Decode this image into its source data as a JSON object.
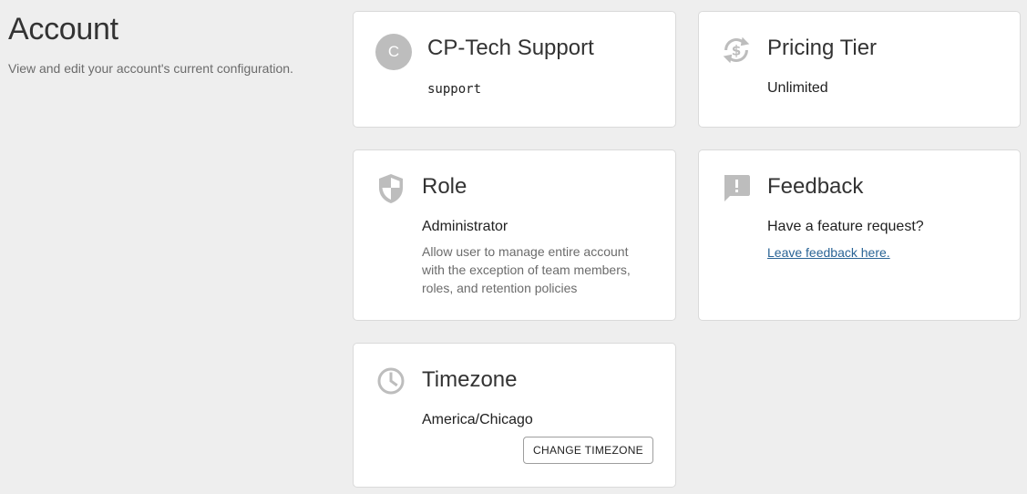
{
  "header": {
    "title": "Account",
    "subtitle": "View and edit your account's current configuration."
  },
  "account_card": {
    "avatar_letter": "C",
    "name": "CP-Tech Support",
    "username": "support"
  },
  "pricing_card": {
    "icon": "dollar-refresh-icon",
    "title": "Pricing Tier",
    "value": "Unlimited"
  },
  "role_card": {
    "icon": "shield-icon",
    "title": "Role",
    "value": "Administrator",
    "description": "Allow user to manage entire account with the exception of team members, roles, and retention policies"
  },
  "feedback_card": {
    "icon": "feedback-icon",
    "title": "Feedback",
    "prompt": "Have a feature request?",
    "link_label": "Leave feedback here."
  },
  "timezone_card": {
    "icon": "clock-icon",
    "title": "Timezone",
    "value": "America/Chicago",
    "button_label": "CHANGE TIMEZONE"
  },
  "colors": {
    "background": "#eeeeee",
    "card": "#ffffff",
    "icon": "#bdbdbd",
    "link": "#2a6496"
  }
}
